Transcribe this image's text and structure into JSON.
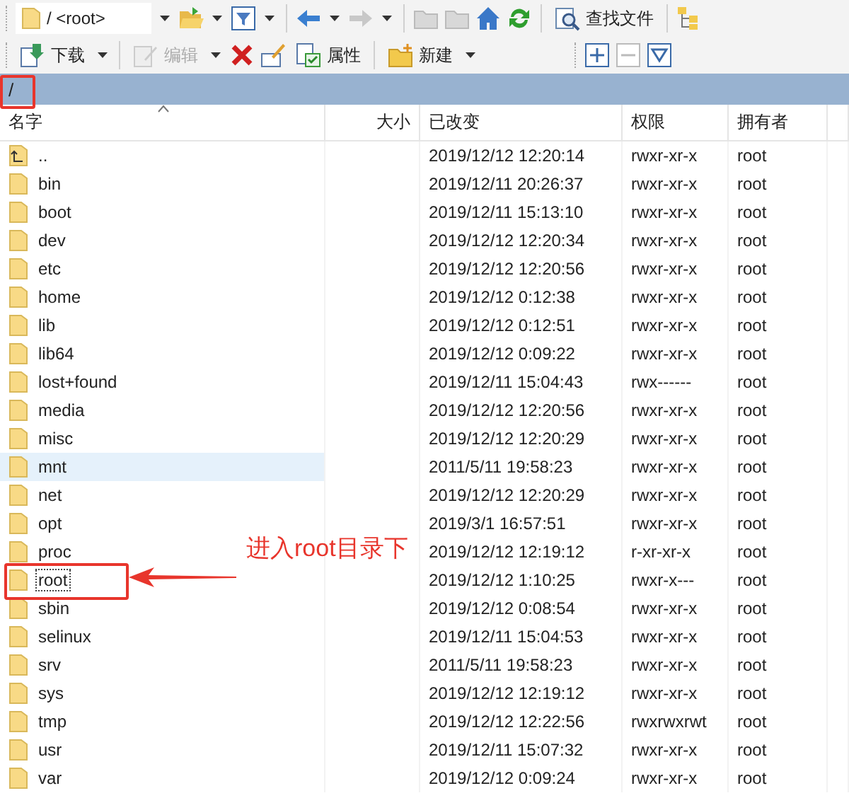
{
  "toolbar_top": {
    "address": "/ <root>",
    "find_button": "查找文件"
  },
  "toolbar_bottom": {
    "buttons": [
      {
        "label": "下载",
        "disabled": false
      },
      {
        "label": "编辑",
        "disabled": true
      },
      {
        "label": "属性",
        "disabled": false
      },
      {
        "label": "新建",
        "disabled": false
      }
    ]
  },
  "path_bar": {
    "path": "/"
  },
  "file_list": {
    "columns": [
      {
        "label": "名字",
        "sorted": true
      },
      {
        "label": "大小",
        "sorted": false
      },
      {
        "label": "已改变",
        "sorted": false
      },
      {
        "label": "权限",
        "sorted": false
      },
      {
        "label": "拥有者",
        "sorted": false
      }
    ],
    "rows": [
      {
        "kind": "parent",
        "name": "..",
        "modified": "2019/12/12 12:20:14",
        "permissions": "rwxr-xr-x",
        "owner": "root",
        "selected": false,
        "focused": false
      },
      {
        "kind": "folder",
        "name": "bin",
        "modified": "2019/12/11 20:26:37",
        "permissions": "rwxr-xr-x",
        "owner": "root",
        "selected": false,
        "focused": false
      },
      {
        "kind": "folder",
        "name": "boot",
        "modified": "2019/12/11 15:13:10",
        "permissions": "rwxr-xr-x",
        "owner": "root",
        "selected": false,
        "focused": false
      },
      {
        "kind": "folder",
        "name": "dev",
        "modified": "2019/12/12 12:20:34",
        "permissions": "rwxr-xr-x",
        "owner": "root",
        "selected": false,
        "focused": false
      },
      {
        "kind": "folder",
        "name": "etc",
        "modified": "2019/12/12 12:20:56",
        "permissions": "rwxr-xr-x",
        "owner": "root",
        "selected": false,
        "focused": false
      },
      {
        "kind": "folder",
        "name": "home",
        "modified": "2019/12/12 0:12:38",
        "permissions": "rwxr-xr-x",
        "owner": "root",
        "selected": false,
        "focused": false
      },
      {
        "kind": "folder",
        "name": "lib",
        "modified": "2019/12/12 0:12:51",
        "permissions": "rwxr-xr-x",
        "owner": "root",
        "selected": false,
        "focused": false
      },
      {
        "kind": "folder",
        "name": "lib64",
        "modified": "2019/12/12 0:09:22",
        "permissions": "rwxr-xr-x",
        "owner": "root",
        "selected": false,
        "focused": false
      },
      {
        "kind": "folder",
        "name": "lost+found",
        "modified": "2019/12/11 15:04:43",
        "permissions": "rwx------",
        "owner": "root",
        "selected": false,
        "focused": false
      },
      {
        "kind": "folder",
        "name": "media",
        "modified": "2019/12/12 12:20:56",
        "permissions": "rwxr-xr-x",
        "owner": "root",
        "selected": false,
        "focused": false
      },
      {
        "kind": "folder",
        "name": "misc",
        "modified": "2019/12/12 12:20:29",
        "permissions": "rwxr-xr-x",
        "owner": "root",
        "selected": false,
        "focused": false
      },
      {
        "kind": "folder",
        "name": "mnt",
        "modified": "2011/5/11 19:58:23",
        "permissions": "rwxr-xr-x",
        "owner": "root",
        "selected": true,
        "focused": false
      },
      {
        "kind": "folder",
        "name": "net",
        "modified": "2019/12/12 12:20:29",
        "permissions": "rwxr-xr-x",
        "owner": "root",
        "selected": false,
        "focused": false
      },
      {
        "kind": "folder",
        "name": "opt",
        "modified": "2019/3/1 16:57:51",
        "permissions": "rwxr-xr-x",
        "owner": "root",
        "selected": false,
        "focused": false
      },
      {
        "kind": "folder",
        "name": "proc",
        "modified": "2019/12/12 12:19:12",
        "permissions": "r-xr-xr-x",
        "owner": "root",
        "selected": false,
        "focused": false
      },
      {
        "kind": "folder",
        "name": "root",
        "modified": "2019/12/12 1:10:25",
        "permissions": "rwxr-x---",
        "owner": "root",
        "selected": false,
        "focused": true
      },
      {
        "kind": "folder",
        "name": "sbin",
        "modified": "2019/12/12 0:08:54",
        "permissions": "rwxr-xr-x",
        "owner": "root",
        "selected": false,
        "focused": false
      },
      {
        "kind": "folder",
        "name": "selinux",
        "modified": "2019/12/11 15:04:53",
        "permissions": "rwxr-xr-x",
        "owner": "root",
        "selected": false,
        "focused": false
      },
      {
        "kind": "folder",
        "name": "srv",
        "modified": "2011/5/11 19:58:23",
        "permissions": "rwxr-xr-x",
        "owner": "root",
        "selected": false,
        "focused": false
      },
      {
        "kind": "folder",
        "name": "sys",
        "modified": "2019/12/12 12:19:12",
        "permissions": "rwxr-xr-x",
        "owner": "root",
        "selected": false,
        "focused": false
      },
      {
        "kind": "folder",
        "name": "tmp",
        "modified": "2019/12/12 12:22:56",
        "permissions": "rwxrwxrwt",
        "owner": "root",
        "selected": false,
        "focused": false
      },
      {
        "kind": "folder",
        "name": "usr",
        "modified": "2019/12/11 15:07:32",
        "permissions": "rwxr-xr-x",
        "owner": "root",
        "selected": false,
        "focused": false
      },
      {
        "kind": "folder",
        "name": "var",
        "modified": "2019/12/12 0:09:24",
        "permissions": "rwxr-xr-x",
        "owner": "root",
        "selected": false,
        "focused": false
      }
    ]
  },
  "annotation": {
    "text": "进入root目录下"
  }
}
